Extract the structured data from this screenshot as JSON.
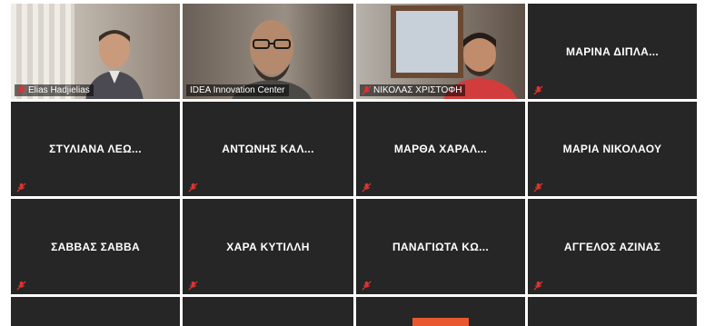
{
  "participants": [
    {
      "name": "Elias Hadjielias",
      "type": "video"
    },
    {
      "name": "IDEA Innovation Center",
      "type": "video",
      "active": true
    },
    {
      "name": "ΝΙΚΟΛΑΣ ΧΡΙΣΤΟΦΗ",
      "type": "video"
    },
    {
      "name": "ΜΑΡΙΝΑ ΔΙΠΛΑ...",
      "type": "name"
    },
    {
      "name": "ΣΤΥΛΙΑΝΑ ΛΕΩ...",
      "type": "name"
    },
    {
      "name": "ΑΝΤΩΝΗΣ ΚΑΛ...",
      "type": "name"
    },
    {
      "name": "ΜΑΡΘΑ ΧΑΡΑΛ...",
      "type": "name"
    },
    {
      "name": "ΜΑΡΙΑ ΝΙΚΟΛΑΟΥ",
      "type": "name"
    },
    {
      "name": "ΣΑΒΒΑΣ ΣΑΒΒΑ",
      "type": "name"
    },
    {
      "name": "ΧΑΡΑ ΚΥΤΙΛΛΗ",
      "type": "name"
    },
    {
      "name": "ΠΑΝΑΓΙΩΤΑ ΚΩ...",
      "type": "name"
    },
    {
      "name": "ΑΓΓΕΛΟΣ ΑΖΙΝΑΣ",
      "type": "name"
    }
  ],
  "icons": {
    "muted": "mic-muted-icon"
  },
  "colors": {
    "tile_bg": "#262626",
    "active_border": "#c8e35a",
    "mute_red": "#e0322f",
    "accent_button": "#e8572f"
  }
}
